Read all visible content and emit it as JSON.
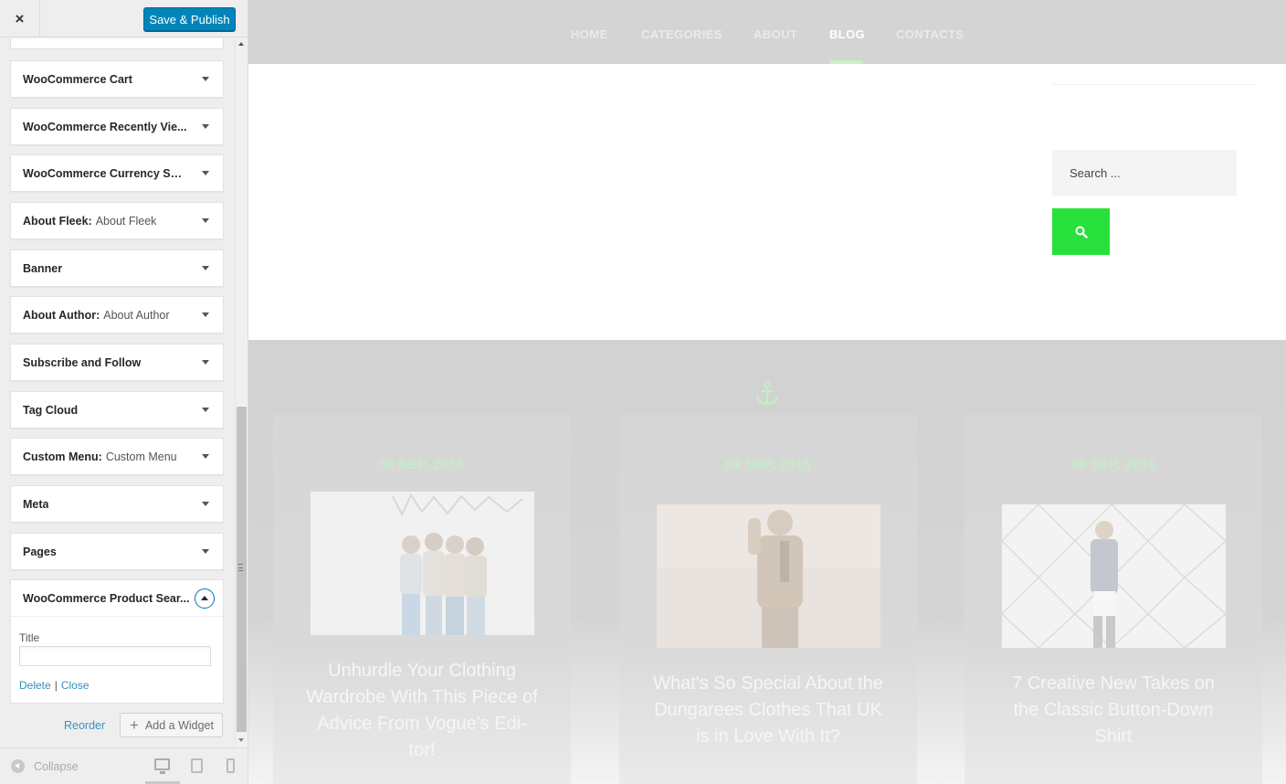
{
  "sidebar": {
    "close_label": "×",
    "publish_label": "Save & Publish",
    "widgets": [
      {
        "title": "WooCommerce Cart",
        "subtitle": ""
      },
      {
        "title": "WooCommerce Recently Vie...",
        "subtitle": ""
      },
      {
        "title": "WooCommerce Currency Swi...",
        "subtitle": ""
      },
      {
        "title": "About Fleek:",
        "subtitle": "About Fleek"
      },
      {
        "title": "Banner",
        "subtitle": ""
      },
      {
        "title": "About Author:",
        "subtitle": "About Author"
      },
      {
        "title": "Subscribe and Follow",
        "subtitle": ""
      },
      {
        "title": "Tag Cloud",
        "subtitle": ""
      },
      {
        "title": "Custom Menu:",
        "subtitle": "Custom Menu"
      },
      {
        "title": "Meta",
        "subtitle": ""
      },
      {
        "title": "Pages",
        "subtitle": ""
      }
    ],
    "open_widget": {
      "title": "WooCommerce Product Sear...",
      "field_label": "Title",
      "field_value": "",
      "delete_label": "Delete",
      "separator": "|",
      "close_label": "Close"
    },
    "reorder_label": "Reorder",
    "add_widget_label": "Add a Widget",
    "footer": {
      "collapse_label": "Collapse",
      "devices": [
        "desktop-icon",
        "tablet-icon",
        "mobile-icon"
      ],
      "active_device": "desktop"
    }
  },
  "preview": {
    "nav": [
      {
        "label": "HOME",
        "active": false
      },
      {
        "label": "CATEGORIES",
        "active": false
      },
      {
        "label": "ABOUT",
        "active": false
      },
      {
        "label": "BLOG",
        "active": true
      },
      {
        "label": "CONTACTS",
        "active": false
      }
    ],
    "search_placeholder": "Search ...",
    "accent_color": "#27e03b",
    "posts": [
      {
        "date": "09 SEP, 2016",
        "title": "Unhurdle Your Clothing Wardrobe With This Piece of Advice From Vogue's Edi-tor!"
      },
      {
        "date": "09 SEP, 2016",
        "title": "What's So Special About the Dungarees Clothes That UK is in Love With It?"
      },
      {
        "date": "09 SEP, 2016",
        "title": "7 Creative New Takes on the Classic Button-Down Shirt"
      }
    ]
  }
}
